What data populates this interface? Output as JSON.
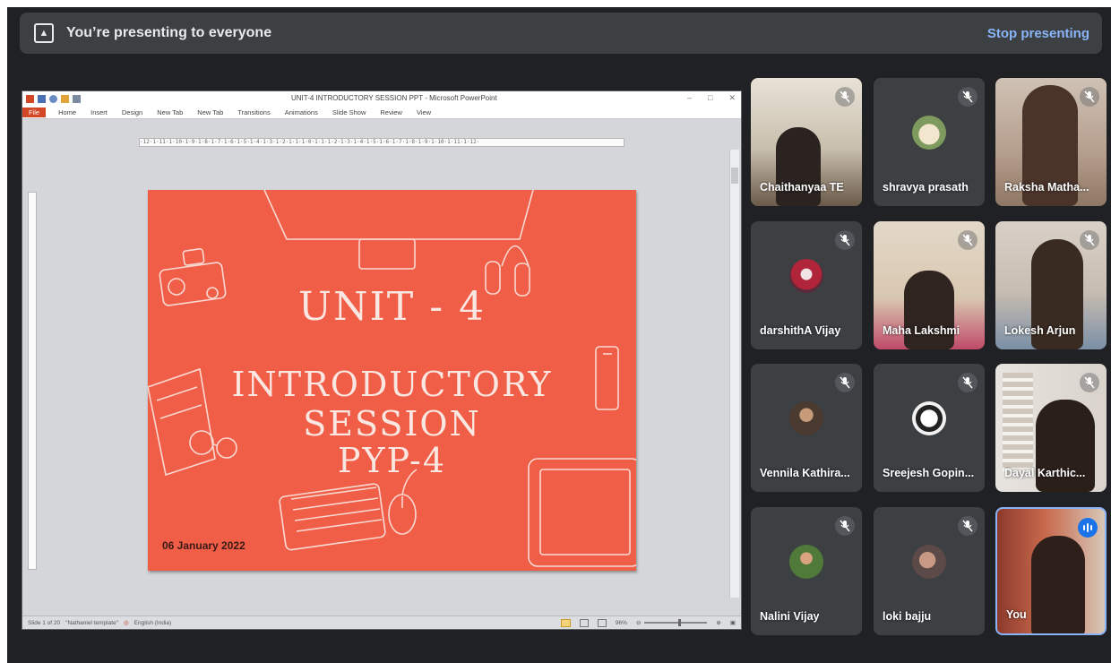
{
  "presenting_bar": {
    "message": "You’re presenting to everyone",
    "stop_label": "Stop presenting"
  },
  "powerpoint": {
    "window_title": "UNIT-4 INTRODUCTORY SESSION PPT - Microsoft PowerPoint",
    "ribbon_tabs": [
      "File",
      "Home",
      "Insert",
      "Design",
      "New Tab",
      "New Tab",
      "Transitions",
      "Animations",
      "Slide Show",
      "Review",
      "View"
    ],
    "ruler_text": "·12·1·11·1·10·1·9·1·8·1·7·1·6·1·5·1·4·1·3·1·2·1·1·1·0·1·1·1·2·1·3·1·4·1·5·1·6·1·7·1·8·1·9·1·10·1·11·1·12·",
    "slide": {
      "line1": "UNIT - 4",
      "line2": "INTRODUCTORY SESSION",
      "line3": "PYP-4",
      "date": "06 January 2022"
    },
    "status_bar": {
      "slide_info": "Slide 1 of 20",
      "theme": "\"Nathaniel template\"",
      "language": "English (India)",
      "zoom": "96%"
    },
    "colors": {
      "slide_bg": "#f05e48",
      "file_tab": "#d24726"
    }
  },
  "participants": [
    {
      "name": "Chaithanyaa TE",
      "muted": true,
      "type": "video"
    },
    {
      "name": "shravya prasath",
      "muted": true,
      "type": "avatar",
      "avatar": "puppy-photo"
    },
    {
      "name": "Raksha Matha...",
      "muted": true,
      "type": "video"
    },
    {
      "name": "darshithA Vijay",
      "muted": true,
      "type": "avatar",
      "avatar": "costume-photo"
    },
    {
      "name": "Maha Lakshmi",
      "muted": true,
      "type": "video"
    },
    {
      "name": "Lokesh Arjun",
      "muted": true,
      "type": "video"
    },
    {
      "name": "Vennila Kathira...",
      "muted": true,
      "type": "avatar",
      "avatar": "portrait-photo"
    },
    {
      "name": "Sreejesh Gopin...",
      "muted": true,
      "type": "avatar",
      "avatar": "zeppelin-logo"
    },
    {
      "name": "Dayal Karthic...",
      "muted": true,
      "type": "video"
    },
    {
      "name": "Nalini Vijay",
      "muted": true,
      "type": "avatar",
      "avatar": "outdoor-photo"
    },
    {
      "name": "loki bajju",
      "muted": true,
      "type": "avatar",
      "avatar": "family-photo"
    },
    {
      "name": "You",
      "muted": false,
      "speaking": true,
      "type": "video"
    }
  ],
  "colors": {
    "background": "#202124",
    "tile": "#3c4043",
    "accent_blue": "#8ab4f8",
    "speaking_blue": "#1a73e8"
  }
}
